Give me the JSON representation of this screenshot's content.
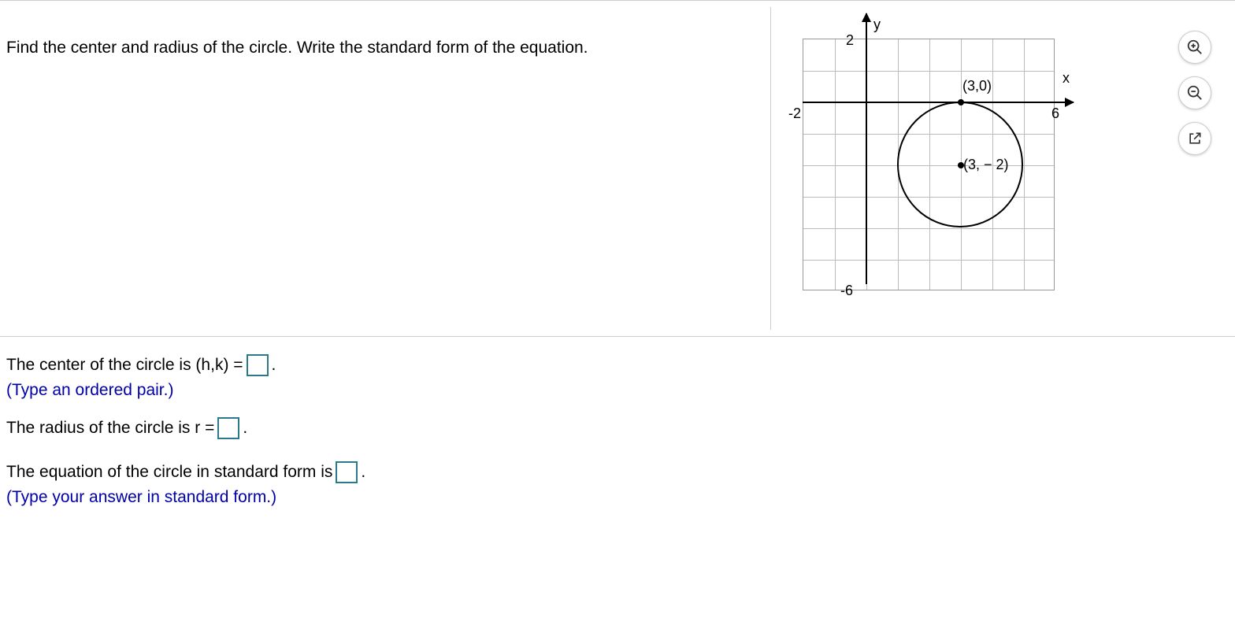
{
  "problem": {
    "prompt": "Find the center and radius of the circle. Write the standard form of the equation."
  },
  "chart_data": {
    "type": "scatter",
    "title": "",
    "xlabel": "x",
    "ylabel": "y",
    "xlim": [
      -2,
      6
    ],
    "ylim": [
      -6,
      2
    ],
    "grid": true,
    "ticks": {
      "x": [
        -2,
        6
      ],
      "y": [
        2,
        -6
      ]
    },
    "circle": {
      "center": [
        3,
        -2
      ],
      "radius": 2
    },
    "labeled_points": [
      {
        "coord": [
          3,
          0
        ],
        "label": "(3,0)"
      },
      {
        "coord": [
          3,
          -2
        ],
        "label": "(3, − 2)"
      }
    ]
  },
  "answers": {
    "center_prefix": "The center of the circle is (h,k) = ",
    "center_hint": "(Type an ordered pair.)",
    "radius_prefix": "The radius of the circle is r = ",
    "equation_prefix": "The equation of the circle in standard form is ",
    "equation_hint": "(Type your answer in standard form.)",
    "period": "."
  },
  "toolbar": {
    "zoom_in": "zoom-in",
    "zoom_out": "zoom-out",
    "popout": "popout"
  }
}
